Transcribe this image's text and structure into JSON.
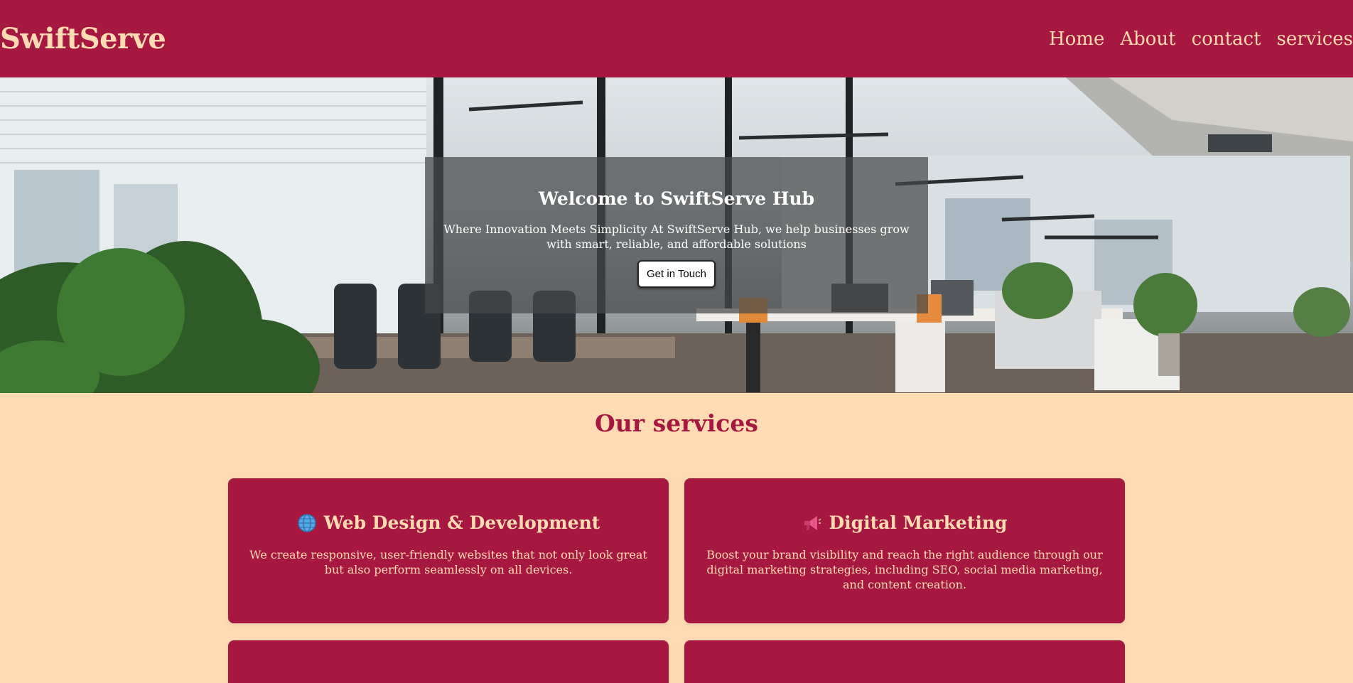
{
  "header": {
    "brand": "SwiftServe",
    "nav": [
      "Home",
      "About",
      "contact",
      "services"
    ]
  },
  "hero": {
    "title": "Welcome to SwiftServe Hub",
    "subtitle": "Where Innovation Meets Simplicity At SwiftServe Hub, we help businesses grow with smart, reliable, and affordable solutions",
    "button_label": "Get in Touch",
    "background": "office-interior-photo"
  },
  "services": {
    "heading": "Our services",
    "cards": [
      {
        "icon": "globe-icon",
        "title": "Web Design & Development",
        "description": "We create responsive, user-friendly websites that not only look great but also perform seamlessly on all devices."
      },
      {
        "icon": "megaphone-icon",
        "title": "Digital Marketing",
        "description": "Boost your brand visibility and reach the right audience through our digital marketing strategies, including SEO, social media marketing, and content creation."
      }
    ]
  },
  "colors": {
    "primary": "#a61840",
    "background": "#ffdbb3",
    "accent_text": "#ffdbb3"
  }
}
